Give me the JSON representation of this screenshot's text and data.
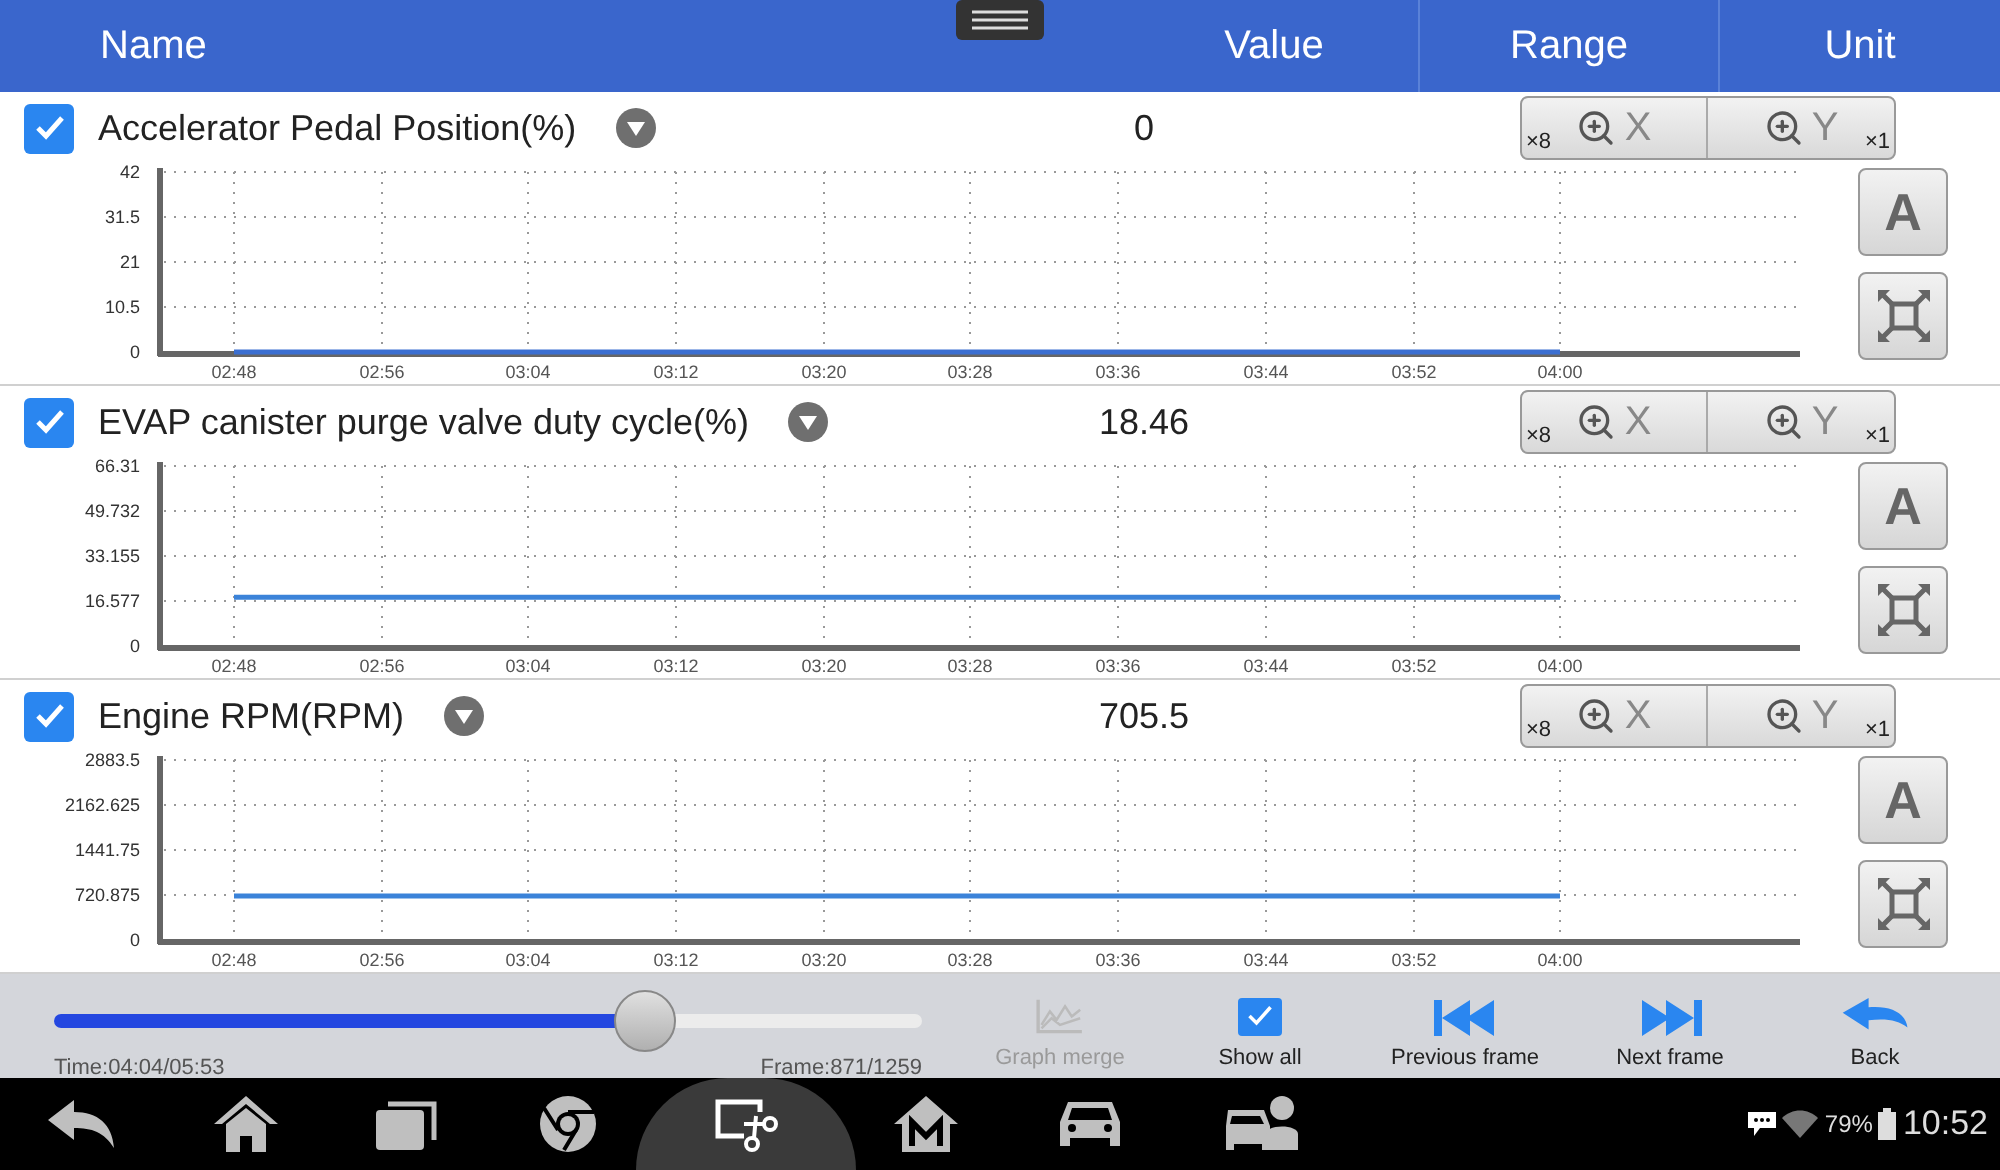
{
  "header": {
    "columns": [
      "Name",
      "Value",
      "Range",
      "Unit"
    ]
  },
  "panels": [
    {
      "checked": true,
      "name": "Accelerator Pedal Position(%)",
      "value": "0",
      "zoom_x": {
        "label": "X",
        "factor": "×8"
      },
      "zoom_y": {
        "label": "Y",
        "factor": "×1"
      },
      "auto_label": "A",
      "chart_data": {
        "type": "line",
        "x": [
          "02:48",
          "02:56",
          "03:04",
          "03:12",
          "03:20",
          "03:28",
          "03:36",
          "03:44",
          "03:52",
          "04:00"
        ],
        "grid": true,
        "series": [
          {
            "color": "#3b6fd1",
            "values": [
              0,
              0,
              0,
              0,
              0,
              0,
              0,
              0,
              0,
              0
            ]
          }
        ],
        "ylim": [
          0,
          42
        ],
        "yticks": [
          0,
          10.5,
          21,
          31.5,
          42
        ]
      }
    },
    {
      "checked": true,
      "name": "EVAP canister purge valve duty cycle(%)",
      "value": "18.46",
      "zoom_x": {
        "label": "X",
        "factor": "×8"
      },
      "zoom_y": {
        "label": "Y",
        "factor": "×1"
      },
      "auto_label": "A",
      "chart_data": {
        "type": "line",
        "x": [
          "02:48",
          "02:56",
          "03:04",
          "03:12",
          "03:20",
          "03:28",
          "03:36",
          "03:44",
          "03:52",
          "04:00"
        ],
        "grid": true,
        "series": [
          {
            "color": "#3b83d9",
            "values": [
              18,
              18,
              18,
              18,
              18,
              18,
              18,
              18,
              18,
              18
            ]
          }
        ],
        "ylim": [
          0,
          66.31
        ],
        "yticks": [
          0,
          16.577,
          33.155,
          49.732,
          66.31
        ]
      }
    },
    {
      "checked": true,
      "name": "Engine RPM(RPM)",
      "value": "705.5",
      "zoom_x": {
        "label": "X",
        "factor": "×8"
      },
      "zoom_y": {
        "label": "Y",
        "factor": "×1"
      },
      "auto_label": "A",
      "chart_data": {
        "type": "line",
        "x": [
          "02:48",
          "02:56",
          "03:04",
          "03:12",
          "03:20",
          "03:28",
          "03:36",
          "03:44",
          "03:52",
          "04:00"
        ],
        "grid": true,
        "series": [
          {
            "color": "#3b83d9",
            "values": [
              705,
              705,
              705,
              705,
              705,
              705,
              705,
              705,
              705,
              705
            ]
          }
        ],
        "ylim": [
          0,
          2883.5
        ],
        "yticks": [
          0,
          720.875,
          1441.75,
          2162.625,
          2883.5
        ]
      }
    }
  ],
  "playback": {
    "level": 0.68,
    "time": "Time:04:04/05:53",
    "frame": "Frame:871/1259"
  },
  "toolbar": [
    {
      "kind": "merge",
      "label": "Graph merge",
      "disabled": true
    },
    {
      "kind": "check",
      "label": "Show all",
      "checked": true
    },
    {
      "kind": "prev",
      "label": "Previous frame"
    },
    {
      "kind": "next",
      "label": "Next frame"
    },
    {
      "kind": "back",
      "label": "Back"
    }
  ],
  "status": {
    "battery": "79%",
    "time": "10:52"
  }
}
